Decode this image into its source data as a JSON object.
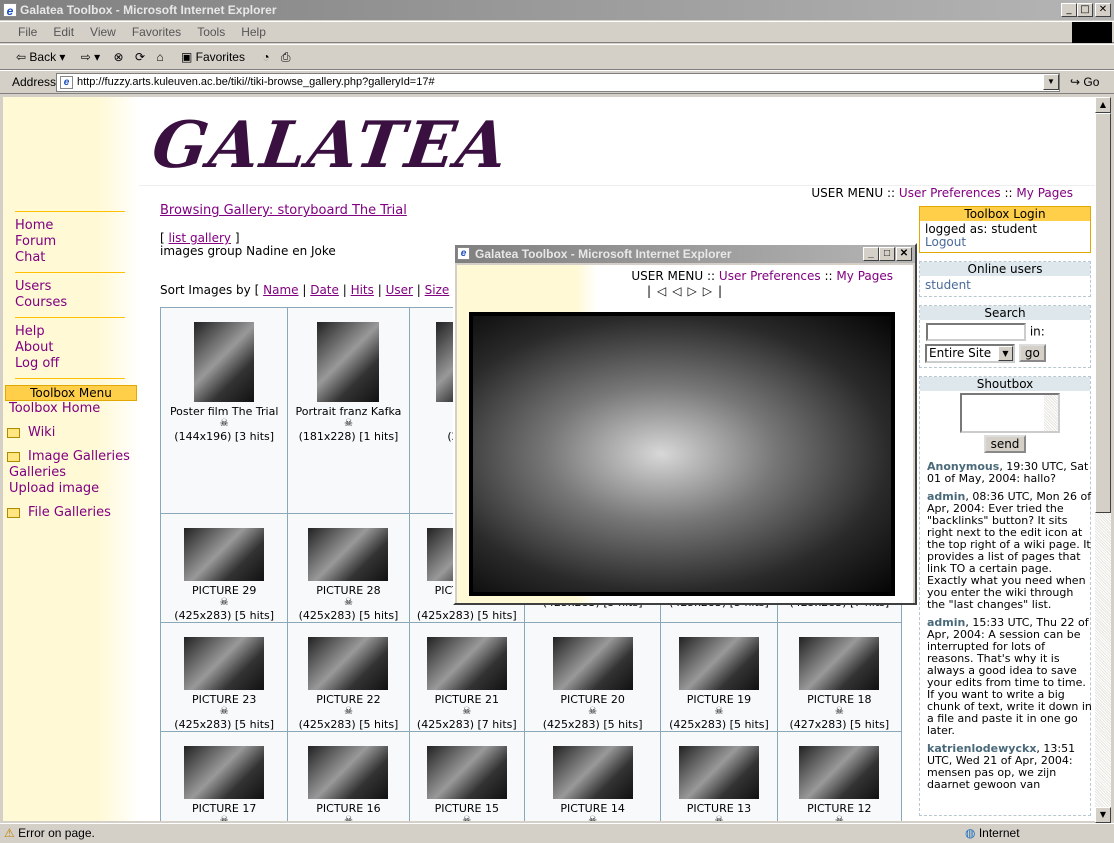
{
  "window": {
    "title": "Galatea Toolbox - Microsoft Internet Explorer"
  },
  "menu": [
    "File",
    "Edit",
    "View",
    "Favorites",
    "Tools",
    "Help"
  ],
  "toolbar": {
    "back": "Back",
    "favorites": "Favorites"
  },
  "address": {
    "label": "Address",
    "url": "http://fuzzy.arts.kuleuven.ac.be/tiki//tiki-browse_gallery.php?galleryId=17#",
    "go": "Go"
  },
  "site": {
    "logo": "GALATEA"
  },
  "usermenu": {
    "label": "USER MENU ::",
    "prefs": "User Preferences",
    "sep": "::",
    "pages": "My Pages"
  },
  "left": {
    "group1": [
      "Home",
      "Forum",
      "Chat"
    ],
    "group2": [
      "Users",
      "Courses"
    ],
    "group3": [
      "Help",
      "About",
      "Log off"
    ],
    "toolbox_menu": "Toolbox Menu",
    "toolbox_home": "Toolbox Home",
    "wiki": "Wiki",
    "image_galleries": "Image Galleries",
    "galleries": "Galleries",
    "upload": "Upload image",
    "file_galleries": "File Galleries"
  },
  "main": {
    "heading": "Browsing Gallery: storyboard The Trial",
    "list_open": "[",
    "list_gallery": "list gallery",
    "list_close": "]",
    "description": "images group Nadine en Joke",
    "sort_label": "Sort Images by [",
    "sort": [
      "Name",
      "Date",
      "Hits",
      "User",
      "Size"
    ],
    "sort_end": "]"
  },
  "gallery": [
    [
      {
        "t": "Poster film The Trial",
        "d": "(144x196) [3 hits]"
      },
      {
        "t": "Portrait franz Kafka",
        "d": "(181x228) [1 hits]"
      },
      {
        "t": "cove",
        "d": "(200x3"
      },
      {
        "t": "",
        "d": ""
      },
      {
        "t": "",
        "d": ""
      },
      {
        "t": "",
        "d": ""
      }
    ],
    [
      {
        "t": "PICTURE 29",
        "d": "(425x283) [5 hits]"
      },
      {
        "t": "PICTURE 28",
        "d": "(425x283) [5 hits]"
      },
      {
        "t": "PICTURE 27",
        "d": "(425x283) [5 hits]"
      },
      {
        "t": "",
        "d": "(425x283) [5 hits]"
      },
      {
        "t": "",
        "d": "(425x283) [5 hits]"
      },
      {
        "t": "",
        "d": "(425x283) [7 hits]"
      }
    ],
    [
      {
        "t": "PICTURE 23",
        "d": "(425x283) [5 hits]"
      },
      {
        "t": "PICTURE 22",
        "d": "(425x283) [5 hits]"
      },
      {
        "t": "PICTURE 21",
        "d": "(425x283) [7 hits]"
      },
      {
        "t": "PICTURE 20",
        "d": "(425x283) [5 hits]"
      },
      {
        "t": "PICTURE 19",
        "d": "(425x283) [5 hits]"
      },
      {
        "t": "PICTURE 18",
        "d": "(427x283) [5 hits]"
      }
    ],
    [
      {
        "t": "PICTURE 17",
        "d": ""
      },
      {
        "t": "PICTURE 16",
        "d": ""
      },
      {
        "t": "PICTURE 15",
        "d": ""
      },
      {
        "t": "PICTURE 14",
        "d": ""
      },
      {
        "t": "PICTURE 13",
        "d": ""
      },
      {
        "t": "PICTURE 12",
        "d": ""
      }
    ]
  ],
  "right": {
    "login_title": "Toolbox Login",
    "logged_as": "logged as: student",
    "logout": "Logout",
    "online_title": "Online users",
    "online_user": "student",
    "search_title": "Search",
    "search_in": "in:",
    "search_scope": "Entire Site",
    "search_go": "go",
    "shout_title": "Shoutbox",
    "send": "send",
    "shouts": [
      {
        "user": "Anonymous",
        "text": ", 19:30 UTC, Sat 01 of May, 2004: hallo?"
      },
      {
        "user": "admin",
        "text": ", 08:36 UTC, Mon 26 of Apr, 2004: Ever tried the \"backlinks\" button? It sits right next to the edit icon at the top right of a wiki page. It provides a list of pages that link TO a certain page. Exactly what you need when you enter the wiki through the \"last changes\" list."
      },
      {
        "user": "admin",
        "text": ", 15:33 UTC, Thu 22 of Apr, 2004: A session can be interrupted for lots of reasons. That's why it is always a good idea to save your edits from time to time. If you want to write a big chunk of text, write it down in a file and paste it in one go later."
      },
      {
        "user": "katrienlodewyckx",
        "text": ", 13:51 UTC, Wed 21 of Apr, 2004: mensen pas op, we zijn daarnet gewoon van"
      }
    ]
  },
  "popup": {
    "title": "Galatea Toolbox - Microsoft Internet Explorer",
    "usermenu": "USER MENU ::",
    "prefs": "User Preferences",
    "sep": "::",
    "pages": "My Pages"
  },
  "status": {
    "text": "Error on page.",
    "zone": "Internet"
  }
}
